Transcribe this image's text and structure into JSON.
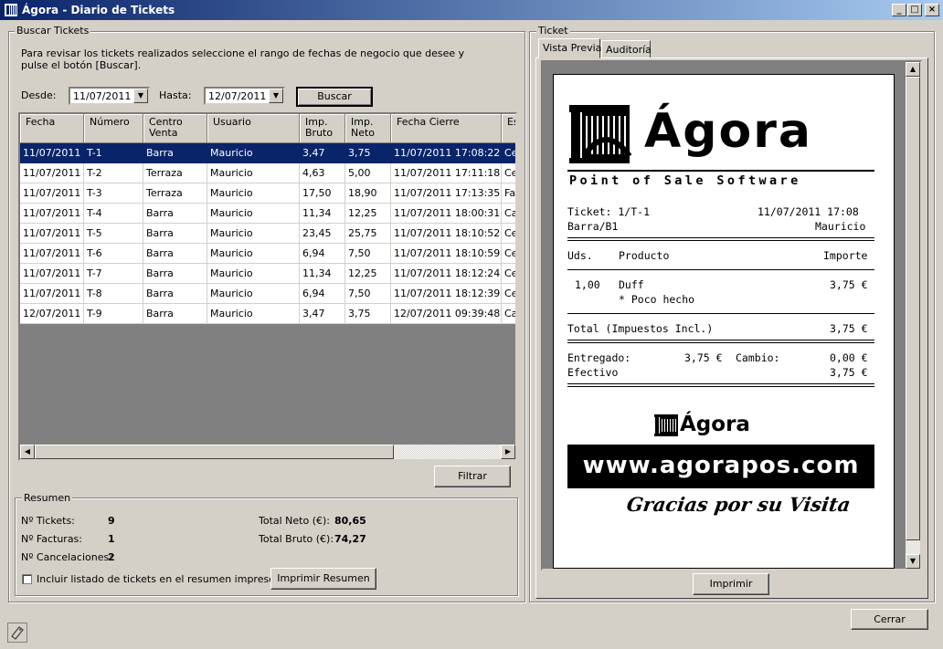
{
  "window": {
    "title": "Ágora - Diario de Tickets",
    "controls": {
      "minimize": "_",
      "maximize": "□",
      "close": "×"
    }
  },
  "search": {
    "group_label": "Buscar Tickets",
    "instructions_line1": "Para revisar los tickets realizados seleccione el rango de fechas de negocio que desee y",
    "instructions_line2": "pulse el botón  [Buscar].",
    "from_label": "Desde:",
    "from_value": "11/07/2011",
    "to_label": "Hasta:",
    "to_value": "12/07/2011",
    "search_button": "Buscar",
    "filter_button": "Filtrar"
  },
  "grid": {
    "columns": [
      {
        "label": "Fecha"
      },
      {
        "label": "Número"
      },
      {
        "label": "Centro Venta"
      },
      {
        "label": "Usuario"
      },
      {
        "label": "Imp. Bruto"
      },
      {
        "label": "Imp. Neto"
      },
      {
        "label": "Fecha Cierre"
      },
      {
        "label": "Es"
      }
    ],
    "rows": [
      {
        "fecha": "11/07/2011",
        "numero": "T-1",
        "centro": "Barra",
        "usuario": "Mauricio",
        "bruto": "3,47",
        "neto": "3,75",
        "cierre": "11/07/2011 17:08:22",
        "estado": "Cer",
        "selected": true
      },
      {
        "fecha": "11/07/2011",
        "numero": "T-2",
        "centro": "Terraza",
        "usuario": "Mauricio",
        "bruto": "4,63",
        "neto": "5,00",
        "cierre": "11/07/2011 17:11:18",
        "estado": "Cer"
      },
      {
        "fecha": "11/07/2011",
        "numero": "T-3",
        "centro": "Terraza",
        "usuario": "Mauricio",
        "bruto": "17,50",
        "neto": "18,90",
        "cierre": "11/07/2011 17:13:35",
        "estado": "Fac"
      },
      {
        "fecha": "11/07/2011",
        "numero": "T-4",
        "centro": "Barra",
        "usuario": "Mauricio",
        "bruto": "11,34",
        "neto": "12,25",
        "cierre": "11/07/2011 18:00:31",
        "estado": "Car"
      },
      {
        "fecha": "11/07/2011",
        "numero": "T-5",
        "centro": "Barra",
        "usuario": "Mauricio",
        "bruto": "23,45",
        "neto": "25,75",
        "cierre": "11/07/2011 18:10:52",
        "estado": "Cer"
      },
      {
        "fecha": "11/07/2011",
        "numero": "T-6",
        "centro": "Barra",
        "usuario": "Mauricio",
        "bruto": "6,94",
        "neto": "7,50",
        "cierre": "11/07/2011 18:10:59",
        "estado": "Cer"
      },
      {
        "fecha": "11/07/2011",
        "numero": "T-7",
        "centro": "Barra",
        "usuario": "Mauricio",
        "bruto": "11,34",
        "neto": "12,25",
        "cierre": "11/07/2011 18:12:24",
        "estado": "Cer"
      },
      {
        "fecha": "11/07/2011",
        "numero": "T-8",
        "centro": "Barra",
        "usuario": "Mauricio",
        "bruto": "6,94",
        "neto": "7,50",
        "cierre": "11/07/2011 18:12:39",
        "estado": "Cer"
      },
      {
        "fecha": "12/07/2011",
        "numero": "T-9",
        "centro": "Barra",
        "usuario": "Mauricio",
        "bruto": "3,47",
        "neto": "3,75",
        "cierre": "12/07/2011 09:39:48",
        "estado": "Car"
      }
    ]
  },
  "summary": {
    "group_label": "Resumen",
    "tickets_label": "Nº Tickets:",
    "tickets_value": "9",
    "facturas_label": "Nº Facturas:",
    "facturas_value": "1",
    "cancel_label": "Nº Cancelaciones:",
    "cancel_value": "2",
    "neto_label": "Total Neto (€):",
    "neto_value": "80,65",
    "bruto_label": "Total Bruto (€):",
    "bruto_value": "74,27",
    "include_label": "Incluir listado de tickets en el resumen impreso",
    "print_summary_button": "Imprimir Resumen"
  },
  "ticket_panel": {
    "group_label": "Ticket",
    "tabs": [
      "Vista Previa",
      "Auditoría"
    ],
    "print_button": "Imprimir",
    "receipt": {
      "logo_text": "Ágora",
      "tagline": "Point of Sale Software",
      "ticket_line": "Ticket: 1/T-1",
      "datetime": "11/07/2011 17:08",
      "location": "Barra/B1",
      "user": "Mauricio",
      "col_qty": "Uds.",
      "col_product": "Producto",
      "col_amount": "Importe",
      "item_qty": "1,00",
      "item_name": "Duff",
      "item_amount": "3,75 €",
      "item_note": "* Poco hecho",
      "total_label": "Total (Impuestos Incl.)",
      "total_value": "3,75 €",
      "delivered_label": "Entregado:",
      "delivered_value": "3,75 €",
      "change_label": "Cambio:",
      "change_value": "0,00 €",
      "cash_label": "Efectivo",
      "cash_value": "3,75 €",
      "footer_logo_text": "Ágora",
      "website": "www.agorapos.com",
      "thanks": "Gracias por su Visita"
    }
  },
  "close_button": "Cerrar",
  "icons": {
    "app": "agora-logo-icon",
    "status": "tag-icon"
  },
  "colors": {
    "selection": "#0a246a",
    "face": "#d4d0c8",
    "title_start": "#0a246a",
    "title_end": "#a6caf0"
  }
}
